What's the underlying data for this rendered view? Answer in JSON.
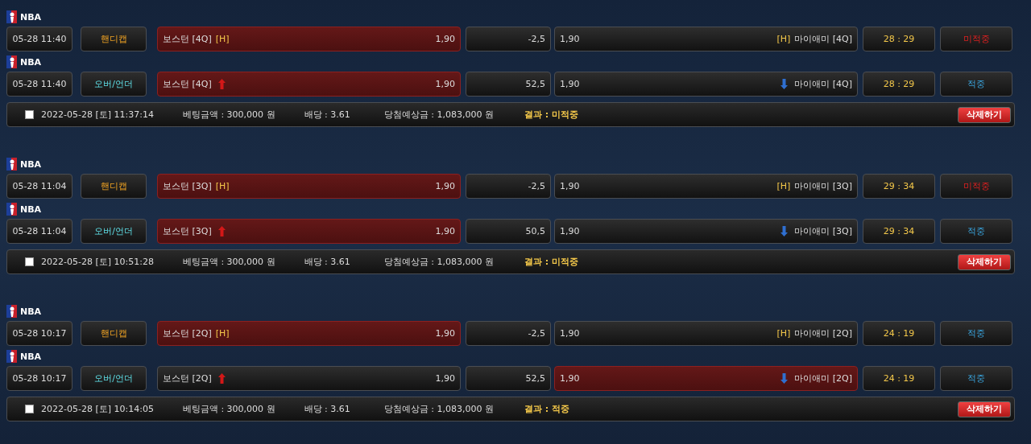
{
  "slips": [
    {
      "bets": [
        {
          "kind": "handicap",
          "league": "NBA",
          "time": "05-28 11:40",
          "type": "핸디캡",
          "home": {
            "name": "보스턴 [4Q]",
            "tag": "[H]",
            "odds": "1,90",
            "selected": true
          },
          "line": "-2,5",
          "away": {
            "odds": "1,90",
            "tag": "[H]",
            "name": "마이애미 [4Q]",
            "selected": false
          },
          "score": "28 : 29",
          "result": {
            "text": "미적중",
            "hit": false
          }
        },
        {
          "kind": "over_under",
          "league": "NBA",
          "time": "05-28 11:40",
          "type": "오버/언더",
          "home": {
            "name": "보스턴 [4Q]",
            "odds": "1,90",
            "selected": true
          },
          "line": "52,5",
          "away": {
            "odds": "1,90",
            "name": "마이애미 [4Q]",
            "selected": false
          },
          "score": "28 : 29",
          "result": {
            "text": "적중",
            "hit": true
          }
        }
      ],
      "summary": {
        "checked": false,
        "date": "2022-05-28 [토] 11:37:14",
        "amount": "베팅금액 : 300,000 원",
        "odds": "배당 : 3.61",
        "payout": "당첨예상금 : 1,083,000 원",
        "result": "결과 : 미적중",
        "button": "삭제하기"
      }
    },
    {
      "bets": [
        {
          "kind": "handicap",
          "league": "NBA",
          "time": "05-28 11:04",
          "type": "핸디캡",
          "home": {
            "name": "보스턴 [3Q]",
            "tag": "[H]",
            "odds": "1,90",
            "selected": true
          },
          "line": "-2,5",
          "away": {
            "odds": "1,90",
            "tag": "[H]",
            "name": "마이애미 [3Q]",
            "selected": false
          },
          "score": "29 : 34",
          "result": {
            "text": "미적중",
            "hit": false
          }
        },
        {
          "kind": "over_under",
          "league": "NBA",
          "time": "05-28 11:04",
          "type": "오버/언더",
          "home": {
            "name": "보스턴 [3Q]",
            "odds": "1,90",
            "selected": true
          },
          "line": "50,5",
          "away": {
            "odds": "1,90",
            "name": "마이애미 [3Q]",
            "selected": false
          },
          "score": "29 : 34",
          "result": {
            "text": "적중",
            "hit": true
          }
        }
      ],
      "summary": {
        "checked": false,
        "date": "2022-05-28 [토] 10:51:28",
        "amount": "베팅금액 : 300,000 원",
        "odds": "배당 : 3.61",
        "payout": "당첨예상금 : 1,083,000 원",
        "result": "결과 : 미적중",
        "button": "삭제하기"
      }
    },
    {
      "bets": [
        {
          "kind": "handicap",
          "league": "NBA",
          "time": "05-28 10:17",
          "type": "핸디캡",
          "home": {
            "name": "보스턴 [2Q]",
            "tag": "[H]",
            "odds": "1,90",
            "selected": true
          },
          "line": "-2,5",
          "away": {
            "odds": "1,90",
            "tag": "[H]",
            "name": "마이애미 [2Q]",
            "selected": false
          },
          "score": "24 : 19",
          "result": {
            "text": "적중",
            "hit": true
          }
        },
        {
          "kind": "over_under",
          "league": "NBA",
          "time": "05-28 10:17",
          "type": "오버/언더",
          "home": {
            "name": "보스턴 [2Q]",
            "odds": "1,90",
            "selected": false
          },
          "line": "52,5",
          "away": {
            "odds": "1,90",
            "name": "마이애미 [2Q]",
            "selected": true
          },
          "score": "24 : 19",
          "result": {
            "text": "적중",
            "hit": true
          }
        }
      ],
      "summary": {
        "checked": false,
        "date": "2022-05-28 [토] 10:14:05",
        "amount": "베팅금액 : 300,000 원",
        "odds": "배당 : 3.61",
        "payout": "당첨예상금 : 1,083,000 원",
        "result": "결과 : 적중",
        "button": "삭제하기"
      }
    }
  ]
}
